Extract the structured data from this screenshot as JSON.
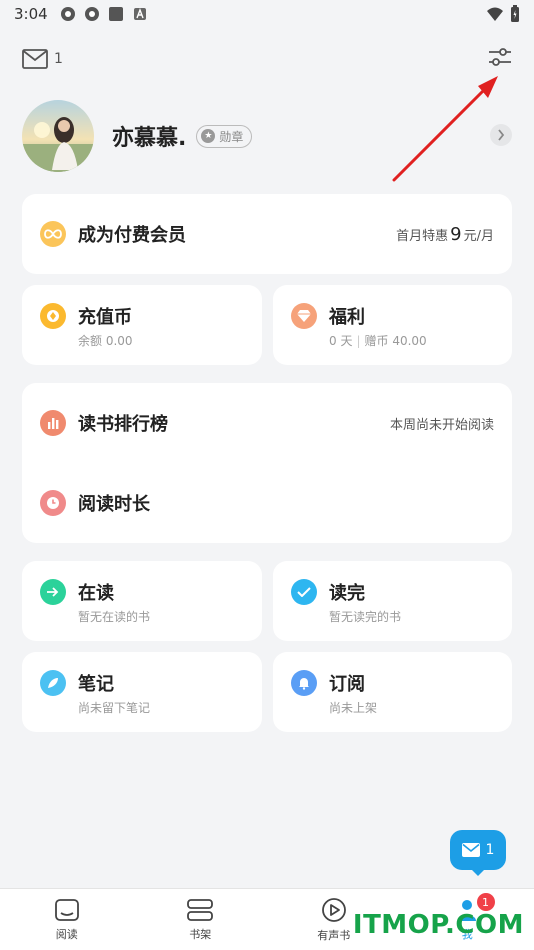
{
  "status_bar": {
    "time": "3:04"
  },
  "topbar": {
    "mail_count": "1"
  },
  "profile": {
    "username": "亦慕慕.",
    "badge": "勋章"
  },
  "vip": {
    "title": "成为付费会员",
    "prefix": "首月特惠",
    "price": "9",
    "unit": "元/月"
  },
  "recharge": {
    "title": "充值币",
    "sub": "余额 0.00"
  },
  "welfare": {
    "title": "福利",
    "sub_days": "0 天",
    "sub_coins": "赠币 40.00"
  },
  "ranking": {
    "title": "读书排行榜",
    "status": "本周尚未开始阅读"
  },
  "duration": {
    "title": "阅读时长"
  },
  "reading": {
    "title": "在读",
    "sub": "暂无在读的书"
  },
  "finished": {
    "title": "读完",
    "sub": "暂无读完的书"
  },
  "notes": {
    "title": "笔记",
    "sub": "尚未留下笔记"
  },
  "subscribe": {
    "title": "订阅",
    "sub": "尚未上架"
  },
  "fab": {
    "count": "1"
  },
  "nav": {
    "items": [
      {
        "label": "阅读",
        "icon": "read-icon"
      },
      {
        "label": "书架",
        "icon": "bookshelf-icon"
      },
      {
        "label": "有声书",
        "icon": "audiobook-icon"
      },
      {
        "label": "我",
        "icon": "user-icon",
        "badge": "1"
      }
    ]
  },
  "watermark": "ITMOP.COM",
  "colors": {
    "accent": "#1d9ee6",
    "arrow": "#e02020",
    "watermark": "#16a34a"
  }
}
